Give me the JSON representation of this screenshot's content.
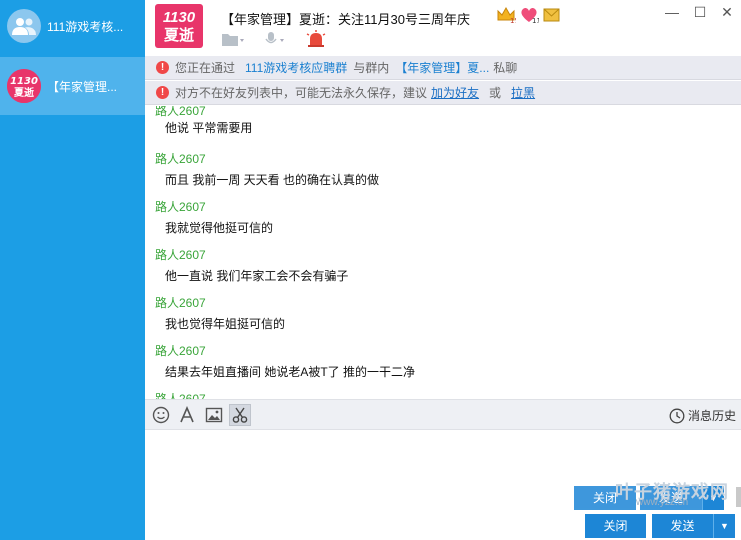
{
  "sidebar": {
    "items": [
      {
        "label": "111游戏考核..."
      },
      {
        "label": "【年家管理..."
      }
    ]
  },
  "header": {
    "logo_line1": "1130",
    "logo_line2": "夏逝",
    "title": "【年家管理】夏逝：关注11月30号三周年庆",
    "badge_level": "15",
    "badge_count": "11"
  },
  "notices": {
    "n1": {
      "prefix": "您正在通过",
      "group": "111游戏考核应聘群",
      "mid": "与群内",
      "member": "【年家管理】夏...",
      "suffix": "私聊"
    },
    "n2": {
      "text": "对方不在好友列表中，可能无法永久保存，建议",
      "add_friend": "加为好友",
      "or": "或",
      "block": "拉黑"
    }
  },
  "messages": [
    {
      "sender": "路人2607",
      "text": "他说 平常需要用"
    },
    {
      "sender": "路人2607",
      "text": "而且 我前一周 天天看 也的确在认真的做"
    },
    {
      "sender": "路人2607",
      "text": "我就觉得他挺可信的"
    },
    {
      "sender": "路人2607",
      "text": "他一直说 我们年家工会不会有骗子"
    },
    {
      "sender": "路人2607",
      "text": "我也觉得年姐挺可信的"
    },
    {
      "sender": "路人2607",
      "text": "结果去年姐直播间 她说老A被T了 推的一干二净"
    },
    {
      "sender": "路人2607",
      "text": ""
    }
  ],
  "toolbar": {
    "history_label": "消息历史"
  },
  "buttons": {
    "close": "关闭",
    "send": "发送",
    "close_ghost": "关闭",
    "send_ghost": "发送"
  },
  "watermark": {
    "line1": "叶子猪游戏网",
    "line2": "www.yzz.cn"
  },
  "colors": {
    "sidebar_bg": "#1c9ee5",
    "sidebar_active": "#4fb3ec",
    "sender": "#3aa53a",
    "button": "#1d86d6",
    "link": "#1b6fc4"
  }
}
